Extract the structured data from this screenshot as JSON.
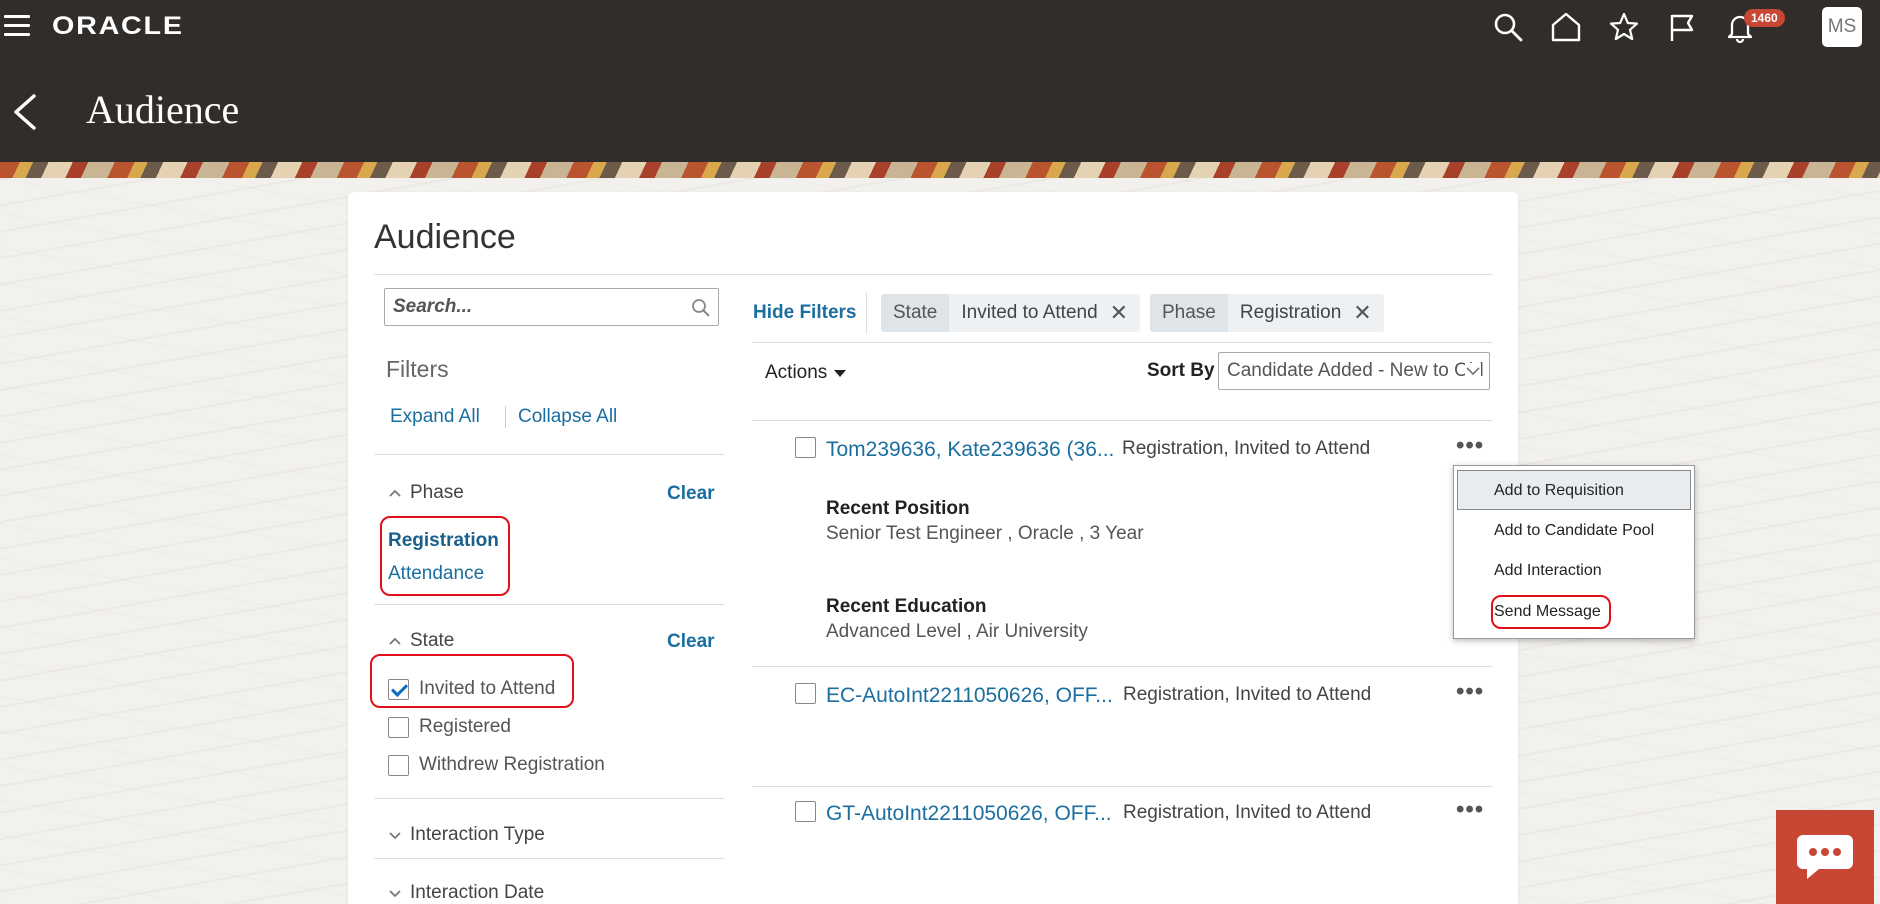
{
  "header": {
    "logo": "ORACLE",
    "title": "Audience",
    "notification_count": "1460",
    "avatar_initials": "MS"
  },
  "card": {
    "title": "Audience"
  },
  "filters": {
    "search_placeholder": "Search...",
    "heading": "Filters",
    "expand_all": "Expand All",
    "collapse_all": "Collapse All",
    "phase": {
      "label": "Phase",
      "clear": "Clear",
      "items": [
        "Registration",
        "Attendance"
      ],
      "selected": "Registration"
    },
    "state": {
      "label": "State",
      "clear": "Clear",
      "items": [
        {
          "label": "Invited to Attend",
          "checked": true
        },
        {
          "label": "Registered",
          "checked": false
        },
        {
          "label": "Withdrew Registration",
          "checked": false
        }
      ]
    },
    "collapsed_sections": [
      "Interaction Type",
      "Interaction Date"
    ]
  },
  "toolbar": {
    "hide_filters": "Hide Filters",
    "chips": [
      {
        "key": "State",
        "value": "Invited to Attend"
      },
      {
        "key": "Phase",
        "value": "Registration"
      }
    ],
    "actions": "Actions",
    "sort_by_label": "Sort By",
    "sort_value": "Candidate Added - New to Old"
  },
  "candidates": [
    {
      "name": "Tom239636, Kate239636 (36...",
      "status": "Registration, Invited to Attend",
      "recent_position_label": "Recent Position",
      "recent_position": "Senior Test Engineer , Oracle , 3 Year",
      "recent_education_label": "Recent Education",
      "recent_education": "Advanced Level , Air University"
    },
    {
      "name": "EC-AutoInt2211050626, OFF...",
      "status": "Registration, Invited to Attend"
    },
    {
      "name": "GT-AutoInt2211050626, OFF...",
      "status": "Registration, Invited to Attend"
    }
  ],
  "context_menu": {
    "items": [
      "Add to Requisition",
      "Add to Candidate Pool",
      "Add Interaction",
      "Send Message"
    ],
    "hovered": "Add to Requisition",
    "highlighted": "Send Message"
  },
  "colors": {
    "topbar": "#312d2a",
    "link": "#1a6ea0",
    "highlight_box": "#e0101a",
    "chat_button": "#c74634"
  }
}
